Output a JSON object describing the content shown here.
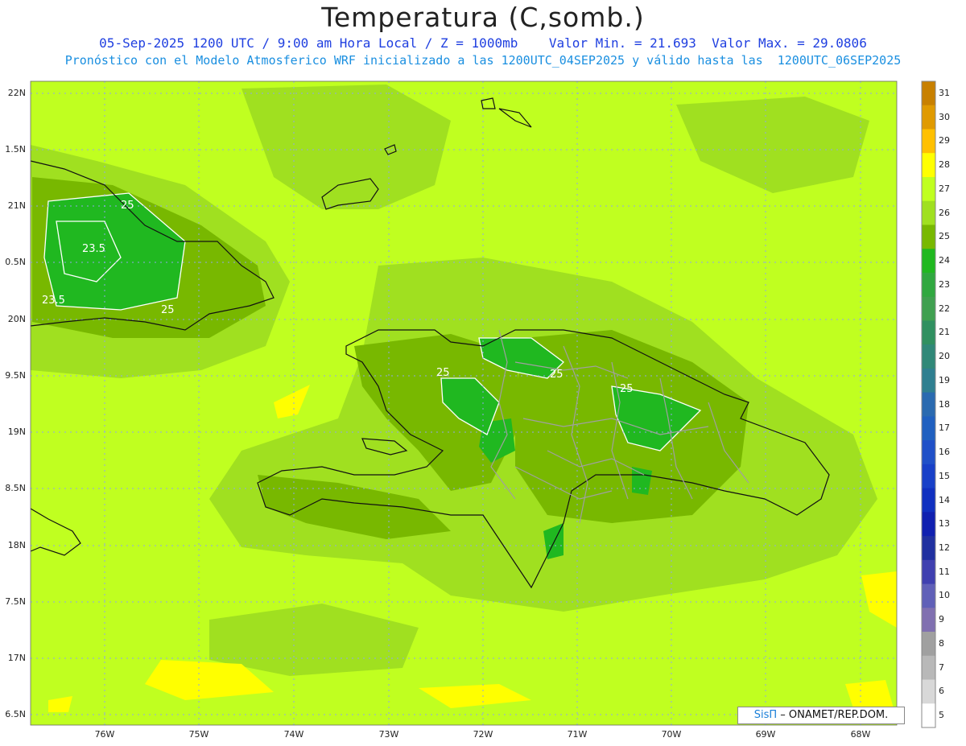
{
  "header": {
    "title": "Temperatura (C,somb.)",
    "line1": "05-Sep-2025 1200 UTC / 9:00 am Hora Local / Z = 1000mb    Valor Min. = 21.693  Valor Max. = 29.0806",
    "line2": "Pronóstico con el Modelo Atmosferico WRF inicializado a las 1200UTC_04SEP2025 y válido hasta las  1200UTC_06SEP2025"
  },
  "axes": {
    "y_labels": [
      "22N",
      "1.5N",
      "21N",
      "0.5N",
      "20N",
      "9.5N",
      "19N",
      "8.5N",
      "18N",
      "7.5N",
      "17N",
      "6.5N"
    ],
    "x_labels": [
      "76W",
      "75W",
      "74W",
      "73W",
      "72W",
      "71W",
      "70W",
      "69W",
      "68W"
    ]
  },
  "colorbar": {
    "labels": [
      "31",
      "30",
      "29",
      "28",
      "27",
      "26",
      "25",
      "24",
      "23",
      "22",
      "21",
      "20",
      "19",
      "18",
      "17",
      "16",
      "15",
      "14",
      "13",
      "12",
      "11",
      "10",
      "9",
      "8",
      "7",
      "6",
      "5"
    ],
    "colors": [
      "#c88000",
      "#e09a00",
      "#ffc000",
      "#ffff00",
      "#c0ff20",
      "#a0e020",
      "#78b800",
      "#20b820",
      "#30a840",
      "#40a050",
      "#309060",
      "#308878",
      "#2f7f90",
      "#2a6ab0",
      "#2060c0",
      "#2050c8",
      "#1840c8",
      "#1030c0",
      "#1020b0",
      "#2030a0",
      "#4040b0",
      "#6060b8",
      "#8070b0",
      "#a0a0a0",
      "#b8b8b8",
      "#d8d8d8",
      "#ffffff"
    ]
  },
  "contour_labels": {
    "c1": "25",
    "c2": "23.5",
    "c3": "23.5",
    "c4": "25",
    "c5": "25",
    "c6": "25",
    "c7": "25"
  },
  "field_colors": {
    "background": "#c0ff20",
    "medium": "#a0e020",
    "dark": "#78b800",
    "darkest": "#20b820",
    "yellow": "#ffff00"
  },
  "credit": {
    "brand": "SisΠ",
    "text": " – ONAMET/REP.DOM."
  }
}
